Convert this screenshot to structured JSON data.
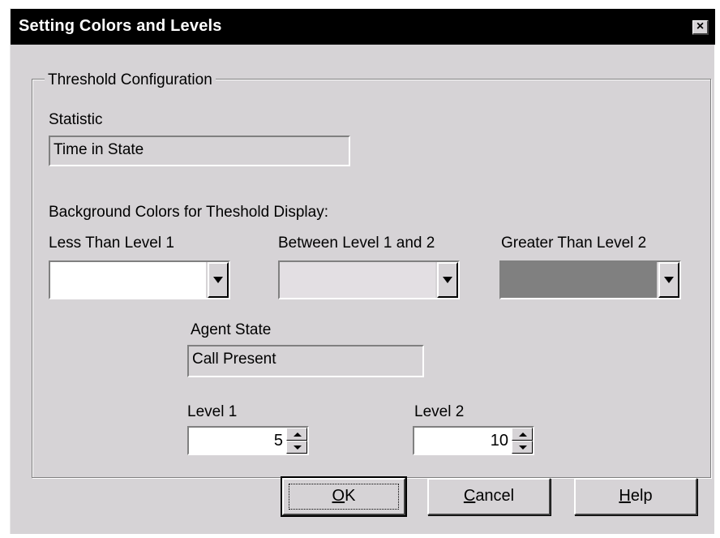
{
  "window": {
    "title": "Setting Colors and Levels",
    "close_label": "×"
  },
  "group": {
    "legend": "Threshold Configuration"
  },
  "statistic": {
    "label": "Statistic",
    "value": "Time in State"
  },
  "background": {
    "label": "Background Colors for Theshold Display:",
    "less_than": {
      "label": "Less Than Level 1",
      "color": "#ffffff"
    },
    "between": {
      "label": "Between Level 1 and 2",
      "color": "#e3dfe3"
    },
    "greater_than": {
      "label": "Greater Than Level 2",
      "color": "#808080"
    }
  },
  "agent_state": {
    "label": "Agent State",
    "value": "Call Present"
  },
  "level1": {
    "label": "Level 1",
    "value": "5"
  },
  "level2": {
    "label": "Level 2",
    "value": "10"
  },
  "buttons": {
    "ok_mnemonic": "O",
    "ok_rest": "K",
    "cancel_mnemonic": "C",
    "cancel_rest": "ancel",
    "help_mnemonic": "H",
    "help_rest": "elp"
  }
}
